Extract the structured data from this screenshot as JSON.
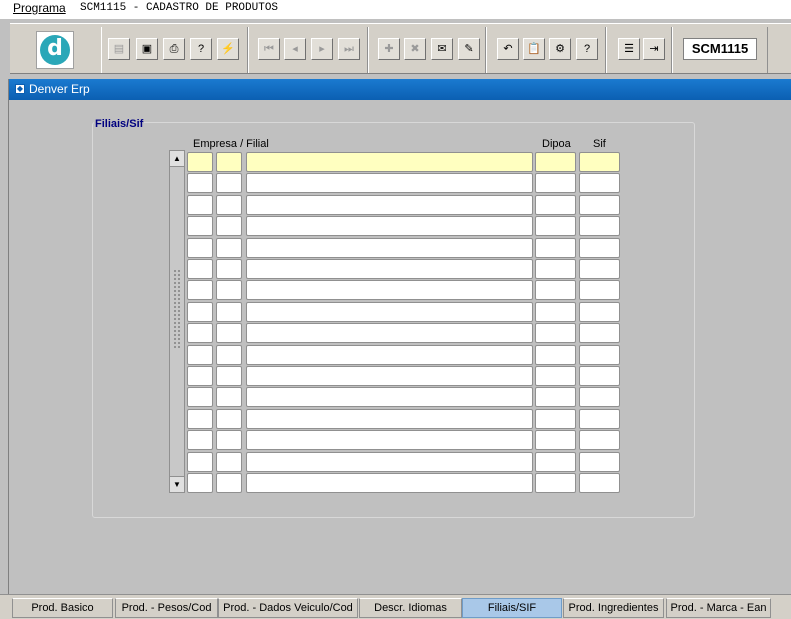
{
  "menubar": {
    "menu_label": "Programa",
    "app_title": "SCM1115 - CADASTRO DE PRODUTOS"
  },
  "toolbar": {
    "logo_letter": "d",
    "program_code": "SCM1115",
    "buttons": [
      {
        "name": "save-icon",
        "glyph": "▤",
        "enabled": false
      },
      {
        "name": "print-preview-icon",
        "glyph": "▣",
        "enabled": true
      },
      {
        "name": "printer-icon",
        "glyph": "⎙",
        "enabled": true
      },
      {
        "name": "help-query-icon",
        "glyph": "?",
        "enabled": true
      },
      {
        "name": "execute-query-icon",
        "glyph": "⚡",
        "enabled": true
      },
      {
        "name": "first-record-icon",
        "glyph": "⏮",
        "enabled": false
      },
      {
        "name": "previous-record-icon",
        "glyph": "◂",
        "enabled": false
      },
      {
        "name": "next-record-icon",
        "glyph": "▸",
        "enabled": false
      },
      {
        "name": "last-record-icon",
        "glyph": "⏭",
        "enabled": false
      },
      {
        "name": "insert-record-icon",
        "glyph": "✚",
        "enabled": false
      },
      {
        "name": "delete-record-icon",
        "glyph": "✖",
        "enabled": false
      },
      {
        "name": "edit-view-icon",
        "glyph": "✉",
        "enabled": true
      },
      {
        "name": "clear-icon",
        "glyph": "✎",
        "enabled": true
      },
      {
        "name": "undo-icon",
        "glyph": "↶",
        "enabled": true
      },
      {
        "name": "clipboard-icon",
        "glyph": "📋",
        "enabled": true
      },
      {
        "name": "tools-icon",
        "glyph": "⚙",
        "enabled": true
      },
      {
        "name": "help-icon",
        "glyph": "?",
        "enabled": true
      },
      {
        "name": "menu-icon",
        "glyph": "☰",
        "enabled": true
      },
      {
        "name": "exit-icon",
        "glyph": "⇥",
        "enabled": true
      }
    ]
  },
  "window": {
    "title": "Denver Erp"
  },
  "panel": {
    "title": "Filiais/Sif",
    "columns": {
      "empresa_filial": "Empresa / Filial",
      "dipoa": "Dipoa",
      "sif": "Sif"
    },
    "row_count": 16,
    "current_row": 0
  },
  "tabs": [
    {
      "label": "Prod. Basico",
      "active": false
    },
    {
      "label": "Prod. - Pesos/Cod",
      "active": false
    },
    {
      "label": "Prod. - Dados Veiculo/Cod",
      "active": false
    },
    {
      "label": "Descr. Idiomas",
      "active": false
    },
    {
      "label": "Filiais/SIF",
      "active": true
    },
    {
      "label": "Prod. Ingredientes",
      "active": false
    },
    {
      "label": "Prod. - Marca - Ean",
      "active": false
    }
  ],
  "colors": {
    "title_bar": "#1a7ad0",
    "current_row": "#ffffc0",
    "panel_title": "#000080",
    "logo": "#2aa7b8"
  }
}
